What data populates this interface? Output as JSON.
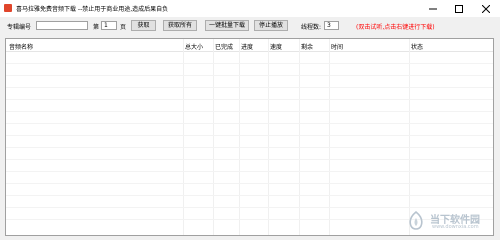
{
  "window": {
    "title": "喜马拉雅免费音频下载 --禁止用于商业用途,造成后果自负"
  },
  "toolbar": {
    "album_label": "专辑编号",
    "album_value": "",
    "page_prefix": "第",
    "page_value": "1",
    "page_suffix": "页",
    "fetch_label": "获取",
    "fetch_all_label": "获取所有",
    "batch_download_label": "一键批量下载",
    "stop_play_label": "停止播放",
    "threads_label": "线程数:",
    "threads_value": "3",
    "hint": "(双击试听,点击右键进行下载)"
  },
  "list": {
    "columns": [
      "音频名称",
      "总大小",
      "已完成",
      "进度",
      "速度",
      "剩余",
      "时间",
      "状态"
    ],
    "rows": []
  },
  "watermark": {
    "text": "当下软件园",
    "sub": "www.downxia.com"
  },
  "colors": {
    "app_icon": "#e0452b",
    "hint": "#ff0000",
    "close_hover": "#e81123"
  },
  "icons": {
    "minimize": "minimize-icon",
    "maximize": "maximize-icon",
    "close": "close-icon"
  }
}
